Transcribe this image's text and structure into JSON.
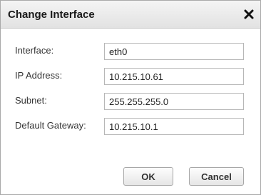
{
  "dialog": {
    "title": "Change Interface",
    "close_icon": "close-icon"
  },
  "form": {
    "interface": {
      "label": "Interface:",
      "value": "eth0"
    },
    "ip_address": {
      "label": "IP Address:",
      "value": "10.215.10.61"
    },
    "subnet": {
      "label": "Subnet:",
      "value": "255.255.255.0"
    },
    "default_gateway": {
      "label": "Default Gateway:",
      "value": "10.215.10.1"
    }
  },
  "buttons": {
    "ok_label": "OK",
    "cancel_label": "Cancel"
  }
}
